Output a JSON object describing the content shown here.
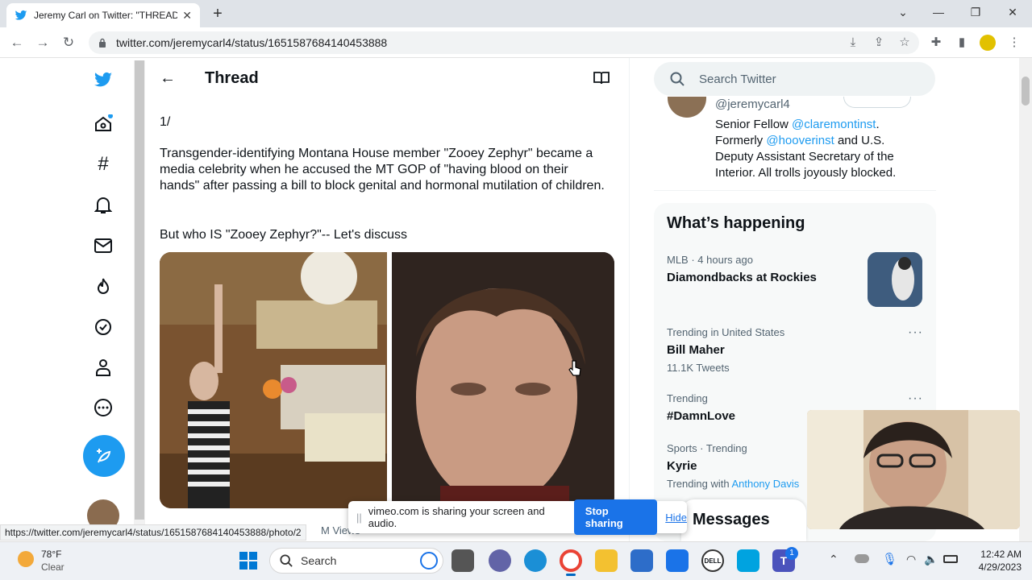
{
  "browser": {
    "tab_title": "Jeremy Carl on Twitter: \"THREAD",
    "url": "twitter.com/jeremycarl4/status/1651587684140453888",
    "status_url": "https://twitter.com/jeremycarl4/status/1651587684140453888/photo/2"
  },
  "sidebar": {
    "icons": [
      "twitter-logo-icon",
      "home-icon",
      "explore-hash-icon",
      "notifications-bell-icon",
      "messages-envelope-icon",
      "flame-icon",
      "verified-check-icon",
      "profile-person-icon",
      "more-dots-icon"
    ]
  },
  "thread": {
    "title": "Thread",
    "number": "1/",
    "paragraph1": "Transgender-identifying Montana House member \"Zooey Zephyr\" became a media celebrity when he accused the MT GOP of \"having blood on their hands\" after passing a bill to block genital and hormonal mutilation of children.",
    "paragraph2": "But who IS \"Zooey Zephyr?\"-- Let's discuss",
    "views_fragment": "M Views"
  },
  "right": {
    "search_placeholder": "Search Twitter",
    "bio_handle": "@jeremycarl4",
    "bio_line1_pre": "Senior Fellow ",
    "bio_link1": "@claremontinst",
    "bio_line1_post": ".",
    "bio_line2_pre": "Formerly ",
    "bio_link2": "@hooverinst",
    "bio_line2_post": " and U.S.",
    "bio_line3": "Deputy Assistant Secretary of the",
    "bio_line4": "Interior. All trolls joyously blocked.",
    "happening_title": "What’s happening",
    "trends": [
      {
        "meta": "MLB · 4 hours ago",
        "name": "Diamondbacks at Rockies",
        "sub": ""
      },
      {
        "meta": "Trending in United States",
        "name": "Bill Maher",
        "sub": "11.1K Tweets"
      },
      {
        "meta": "Trending",
        "name": "#DamnLove",
        "sub": ""
      },
      {
        "meta": "Sports · Trending",
        "name": "Kyrie",
        "sub": "Trending with "
      }
    ],
    "trend_with_link": "Anthony Davis",
    "messages": "Messages"
  },
  "share_bar": {
    "text": "vimeo.com is sharing your screen and audio.",
    "stop_label": "Stop sharing",
    "hide_label": "Hide"
  },
  "taskbar": {
    "weather_temp": "78°F",
    "weather_cond": "Clear",
    "search_label": "Search",
    "time": "12:42 AM",
    "date": "4/29/2023",
    "teams_badge": "1",
    "dell_label": "DELL"
  },
  "colors": {
    "twitter_blue": "#1d9bf0",
    "chrome_blue": "#1a73e8"
  }
}
